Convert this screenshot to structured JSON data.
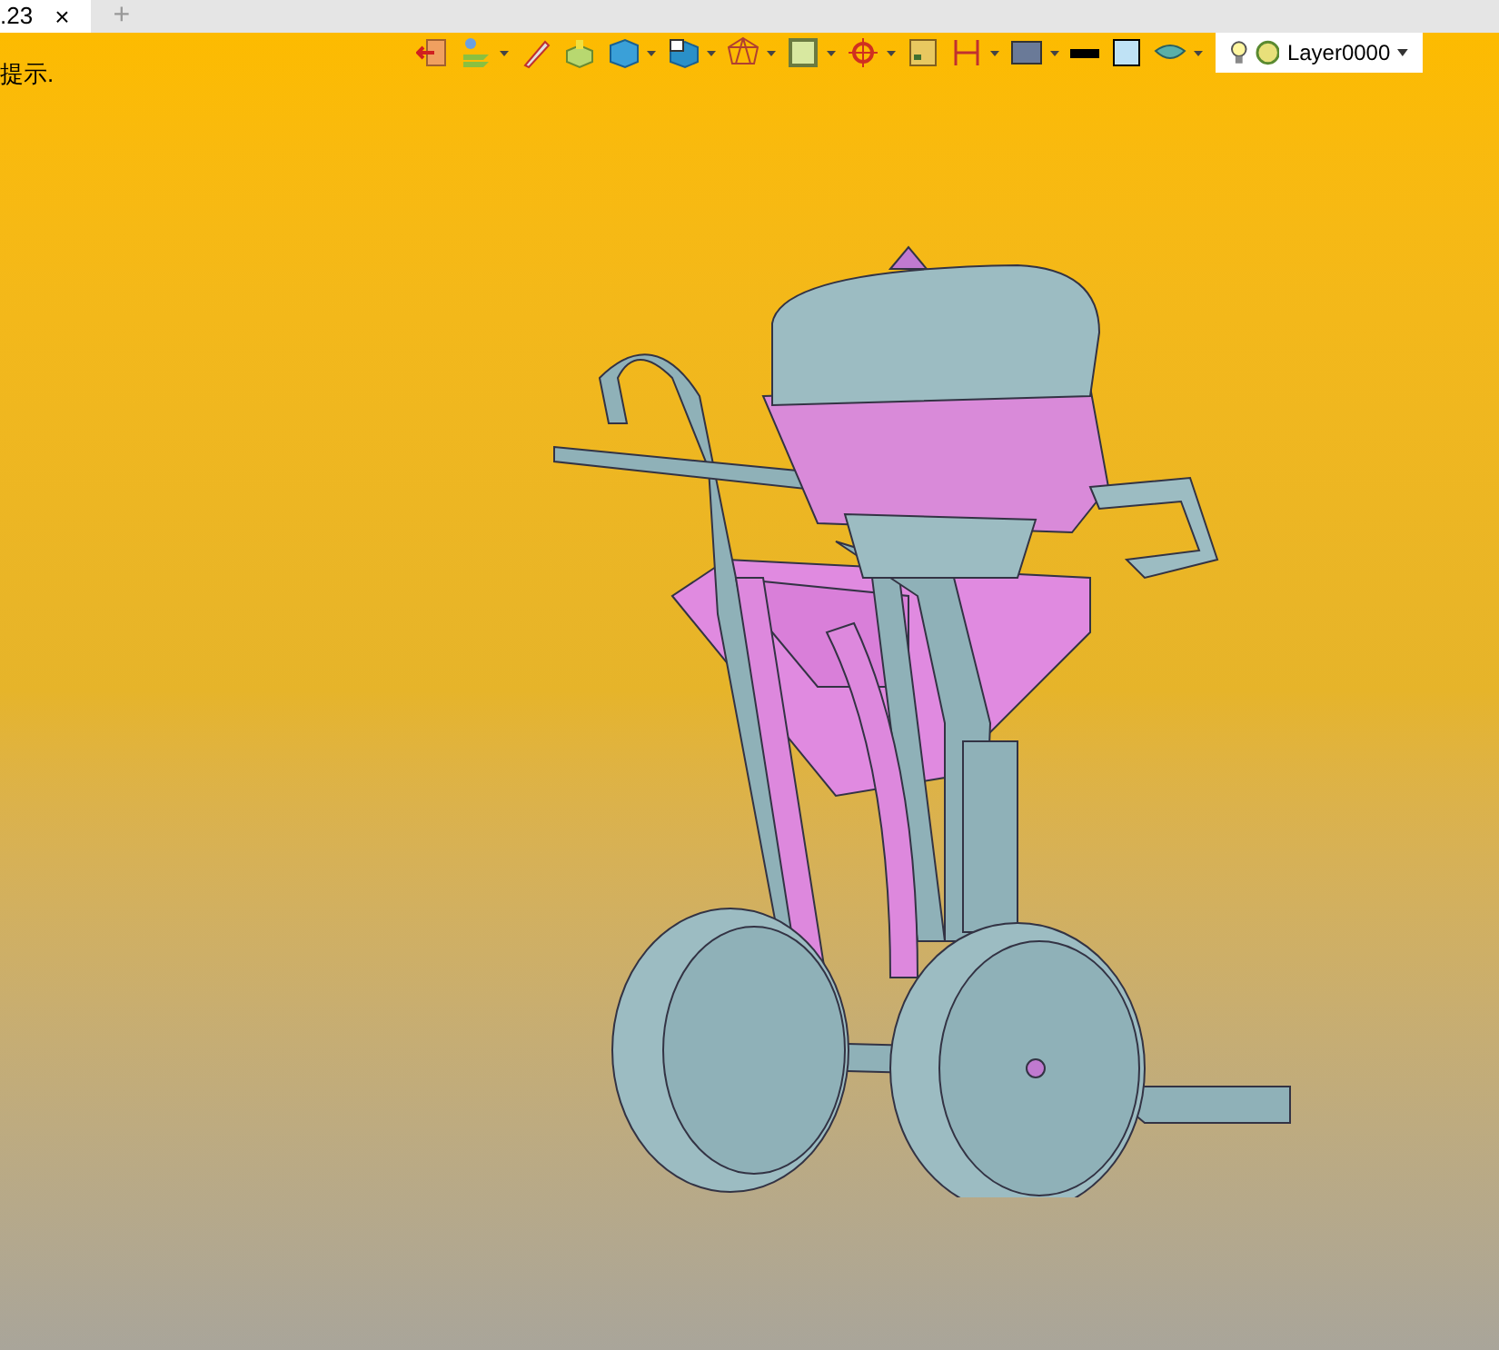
{
  "tab": {
    "label": ".23",
    "close": "×",
    "selected": true
  },
  "new_tab": "+",
  "hint": "提示.",
  "toolbar": [
    {
      "kind": "exit",
      "dropdown": false
    },
    {
      "kind": "layers",
      "dropdown": true
    },
    {
      "kind": "pencil",
      "dropdown": false
    },
    {
      "kind": "box",
      "dropdown": false
    },
    {
      "kind": "cube",
      "dropdown": true
    },
    {
      "kind": "view",
      "dropdown": true
    },
    {
      "kind": "wire",
      "dropdown": true
    },
    {
      "kind": "frame",
      "dropdown": true
    },
    {
      "kind": "target",
      "dropdown": true
    },
    {
      "kind": "square",
      "dropdown": false
    },
    {
      "kind": "dimension",
      "dropdown": true
    },
    {
      "kind": "monitor",
      "dropdown": true
    },
    {
      "kind": "linecolor",
      "dropdown": false
    },
    {
      "kind": "fillcolor",
      "dropdown": false
    },
    {
      "kind": "surface",
      "dropdown": true
    }
  ],
  "layer": {
    "name": "Layer0000",
    "visible": true
  }
}
